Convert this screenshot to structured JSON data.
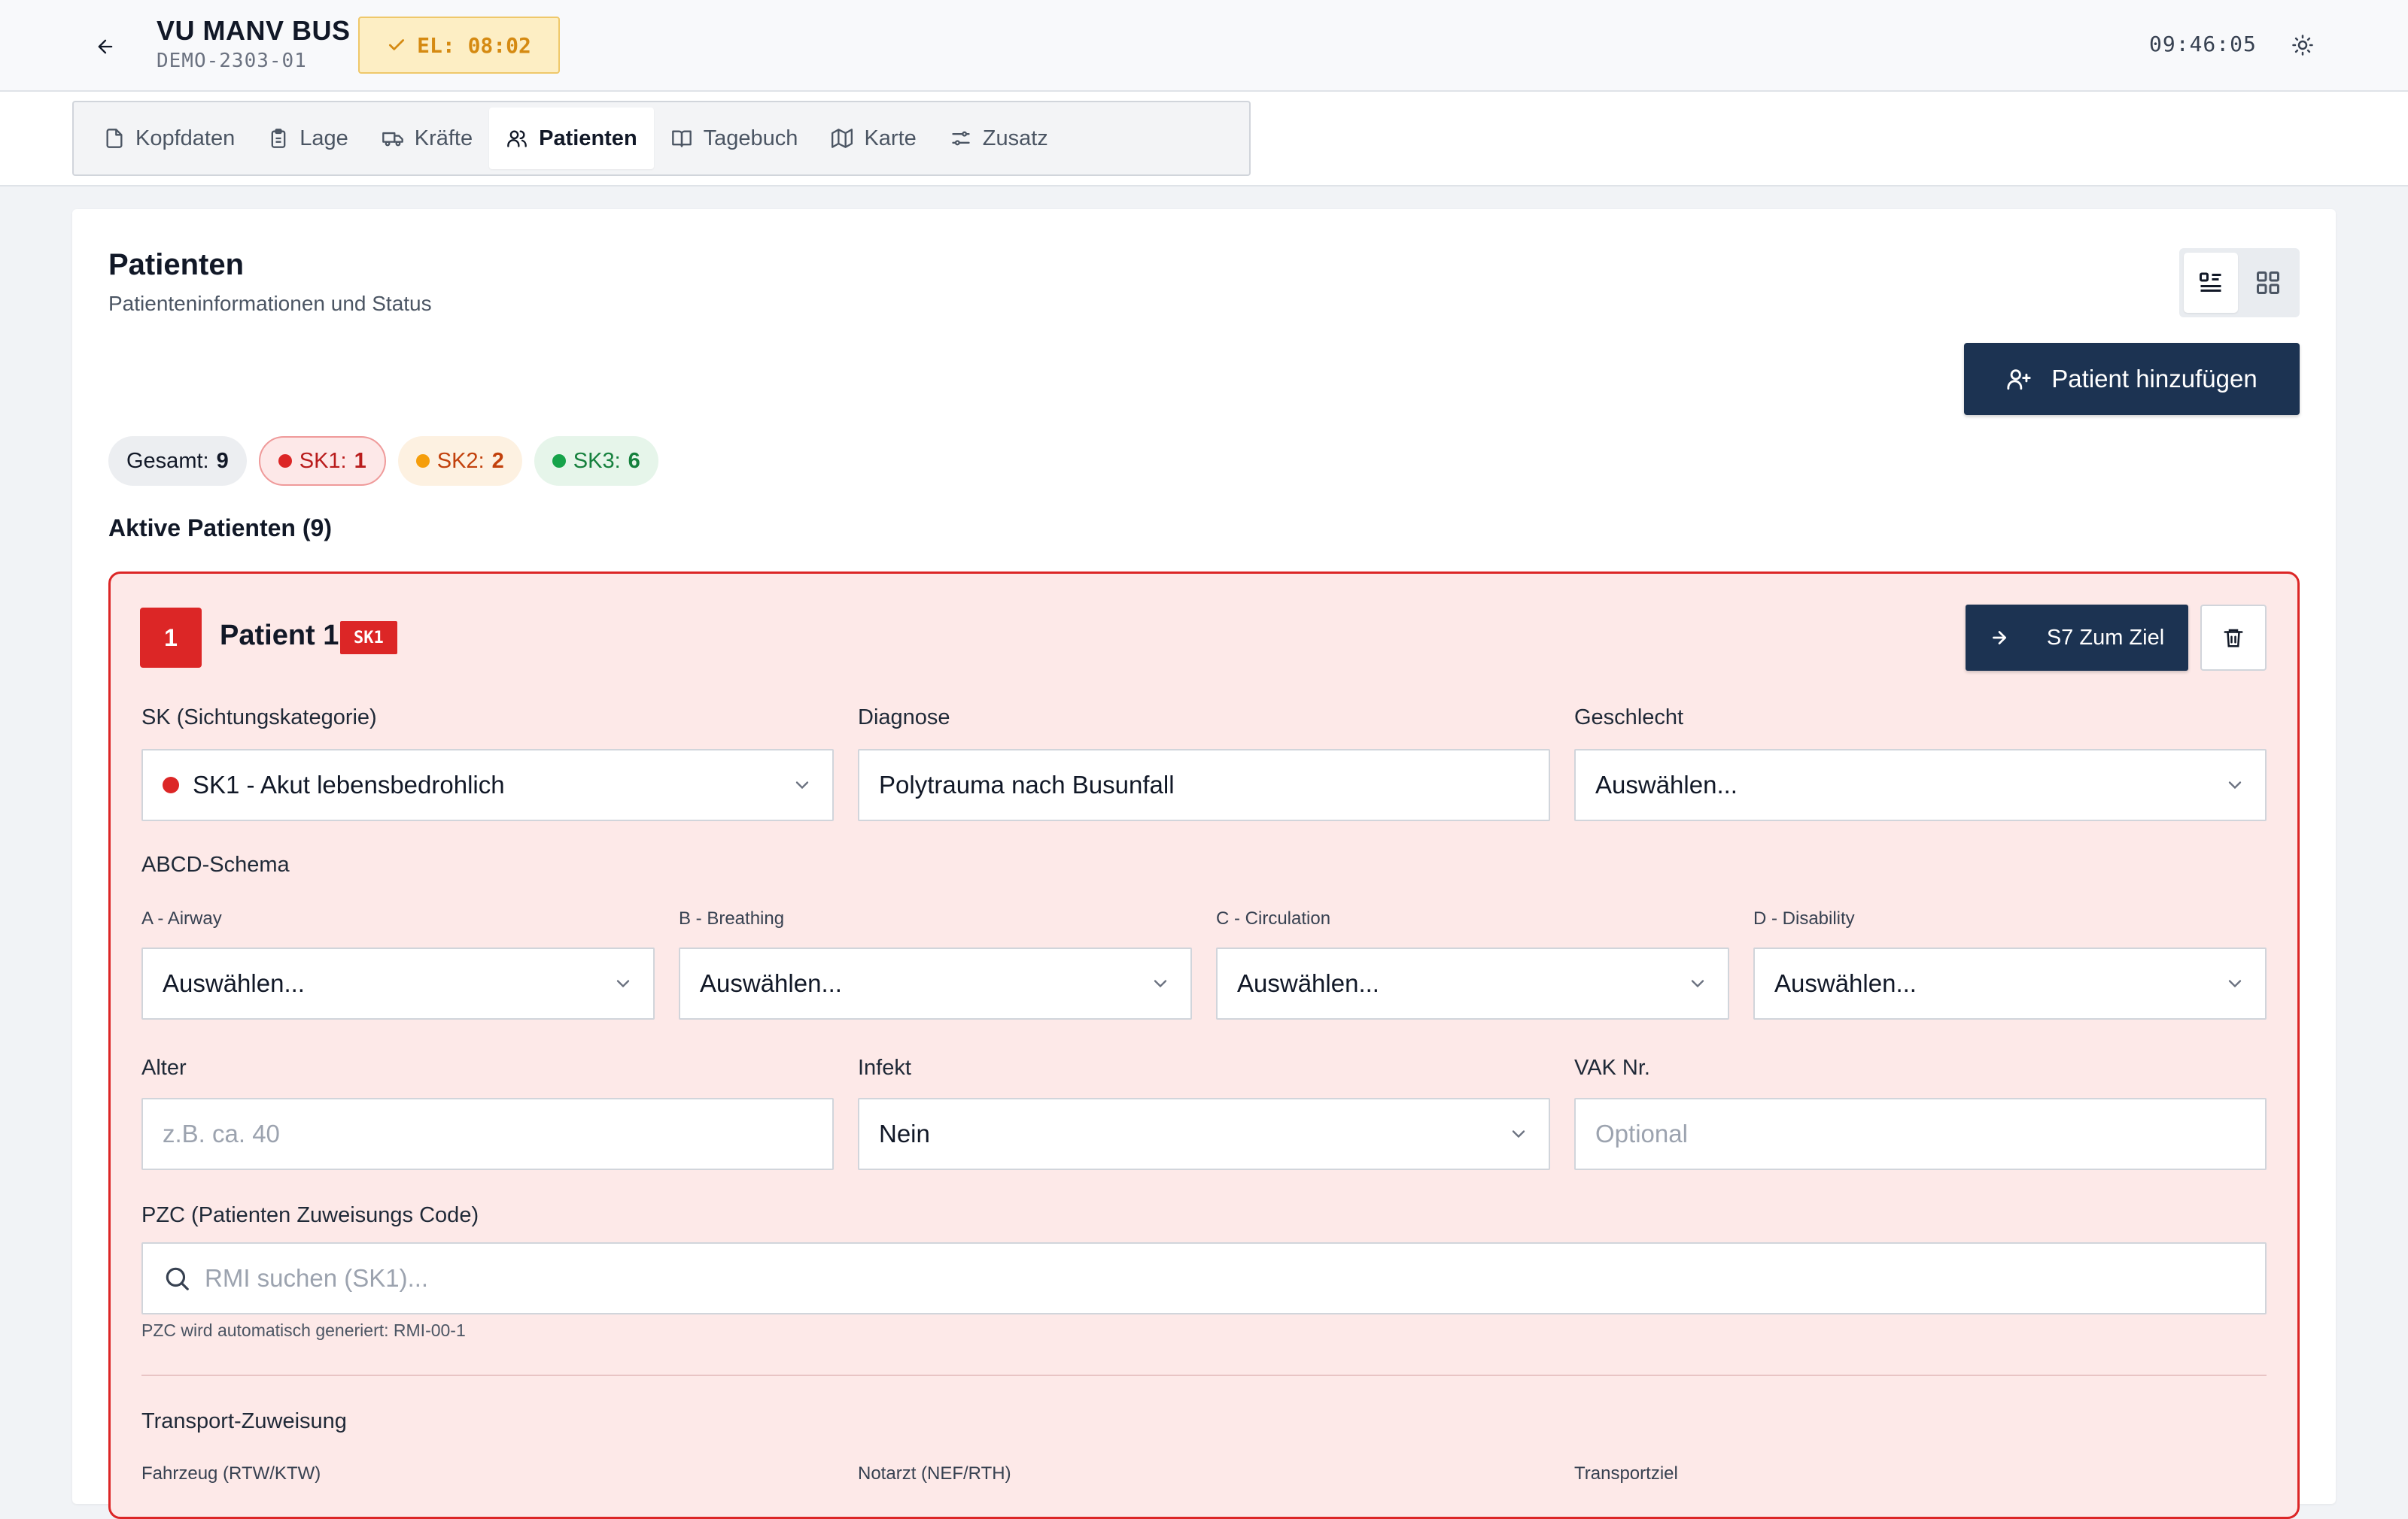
{
  "header": {
    "title": "VU MANV BUS",
    "subtitle": "DEMO-2303-01",
    "el_badge": "EL: 08:02",
    "clock": "09:46:05"
  },
  "tabs": [
    {
      "label": "Kopfdaten",
      "icon": "file-icon"
    },
    {
      "label": "Lage",
      "icon": "clipboard-icon"
    },
    {
      "label": "Kräfte",
      "icon": "truck-icon"
    },
    {
      "label": "Patienten",
      "icon": "users-icon",
      "active": true
    },
    {
      "label": "Tagebuch",
      "icon": "book-icon"
    },
    {
      "label": "Karte",
      "icon": "map-icon"
    },
    {
      "label": "Zusatz",
      "icon": "sliders-icon"
    }
  ],
  "page": {
    "title": "Patienten",
    "subtitle": "Patienteninformationen und Status",
    "add_button": "Patient hinzufügen",
    "section_title": "Aktive Patienten (9)"
  },
  "stats": {
    "total_label": "Gesamt:",
    "total_value": "9",
    "sk1_label": "SK1:",
    "sk1_value": "1",
    "sk2_label": "SK2:",
    "sk2_value": "2",
    "sk3_label": "SK3:",
    "sk3_value": "6"
  },
  "colors": {
    "sk1": "#dc2626",
    "sk2": "#f59e0b",
    "sk3": "#16a34a",
    "primary": "#1c3352"
  },
  "patient": {
    "number": "1",
    "name": "Patient 1",
    "tag": "SK1",
    "goal_button": "S7 Zum Ziel",
    "sk_label": "SK (Sichtungskategorie)",
    "sk_value": "SK1 - Akut lebensbedrohlich",
    "diagnose_label": "Diagnose",
    "diagnose_value": "Polytrauma nach Busunfall",
    "geschlecht_label": "Geschlecht",
    "geschlecht_value": "Auswählen...",
    "abcd_label": "ABCD-Schema",
    "airway_label": "A - Airway",
    "airway_value": "Auswählen...",
    "breathing_label": "B - Breathing",
    "breathing_value": "Auswählen...",
    "circulation_label": "C - Circulation",
    "circulation_value": "Auswählen...",
    "disability_label": "D - Disability",
    "disability_value": "Auswählen...",
    "alter_label": "Alter",
    "alter_placeholder": "z.B. ca. 40",
    "infekt_label": "Infekt",
    "infekt_value": "Nein",
    "vak_label": "VAK Nr.",
    "vak_placeholder": "Optional",
    "pzc_label": "PZC (Patienten Zuweisungs Code)",
    "pzc_placeholder": "RMI suchen (SK1)...",
    "pzc_hint": "PZC wird automatisch generiert: RMI-00-1",
    "transport_label": "Transport-Zuweisung",
    "fahrzeug_label": "Fahrzeug (RTW/KTW)",
    "notarzt_label": "Notarzt (NEF/RTH)",
    "transportziel_label": "Transportziel"
  }
}
